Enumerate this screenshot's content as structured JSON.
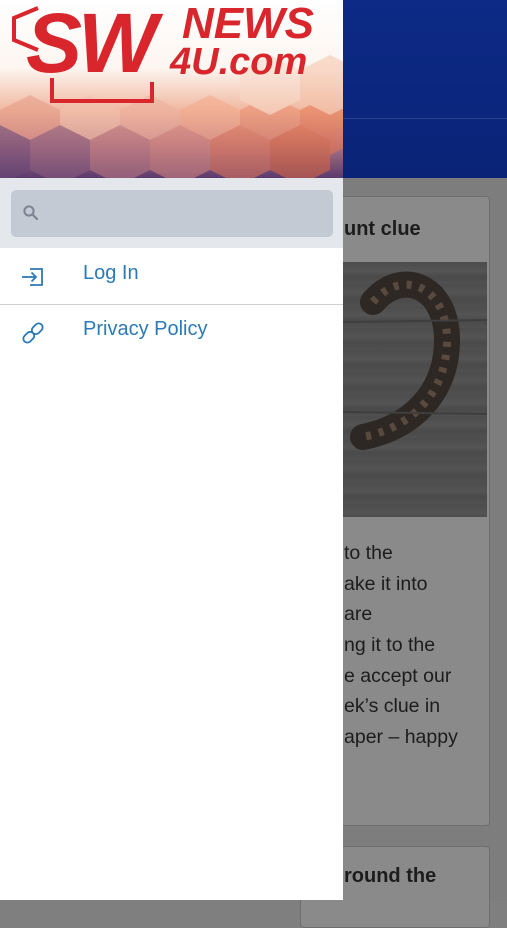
{
  "background": {
    "article1_title": "unt clue",
    "article1_lines": [
      "to the",
      "ake it into",
      "are",
      "ng it to the",
      "e accept our",
      "ek’s clue in",
      "aper – happy"
    ],
    "article2_title": "round the"
  },
  "drawer": {
    "logo": {
      "text_sw": "SW",
      "text_news": "NEWS",
      "text_domain": "4U.com"
    },
    "search": {
      "placeholder": ""
    },
    "menu": [
      {
        "label": "Log In",
        "icon": "login-icon"
      },
      {
        "label": "Privacy Policy",
        "icon": "link-icon"
      }
    ]
  },
  "colors": {
    "accent": "#2b7ab6",
    "logo_red": "#d8262c",
    "header_blue": "#0c2a86"
  }
}
